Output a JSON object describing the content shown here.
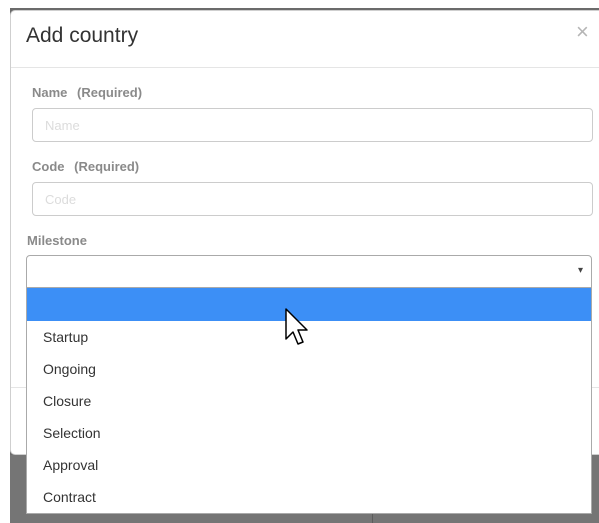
{
  "modal": {
    "title": "Add country",
    "close_glyph": "×",
    "fields": {
      "name": {
        "label": "Name",
        "required": "(Required)",
        "placeholder": "Name",
        "value": ""
      },
      "code": {
        "label": "Code",
        "required": "(Required)",
        "placeholder": "Code",
        "value": ""
      },
      "milestone": {
        "label": "Milestone",
        "selected": "",
        "arrow": "▾"
      }
    }
  },
  "dropdown": {
    "options": [
      "",
      "Startup",
      "Ongoing",
      "Closure",
      "Selection",
      "Approval",
      "Contract"
    ],
    "highlighted_index": 0
  },
  "colors": {
    "highlight": "#3c8ff6",
    "label": "#8a8a8a",
    "backdrop": "#6b6b6b"
  },
  "icons": [
    "close-icon",
    "dropdown-arrow-icon",
    "mouse-pointer-icon"
  ]
}
